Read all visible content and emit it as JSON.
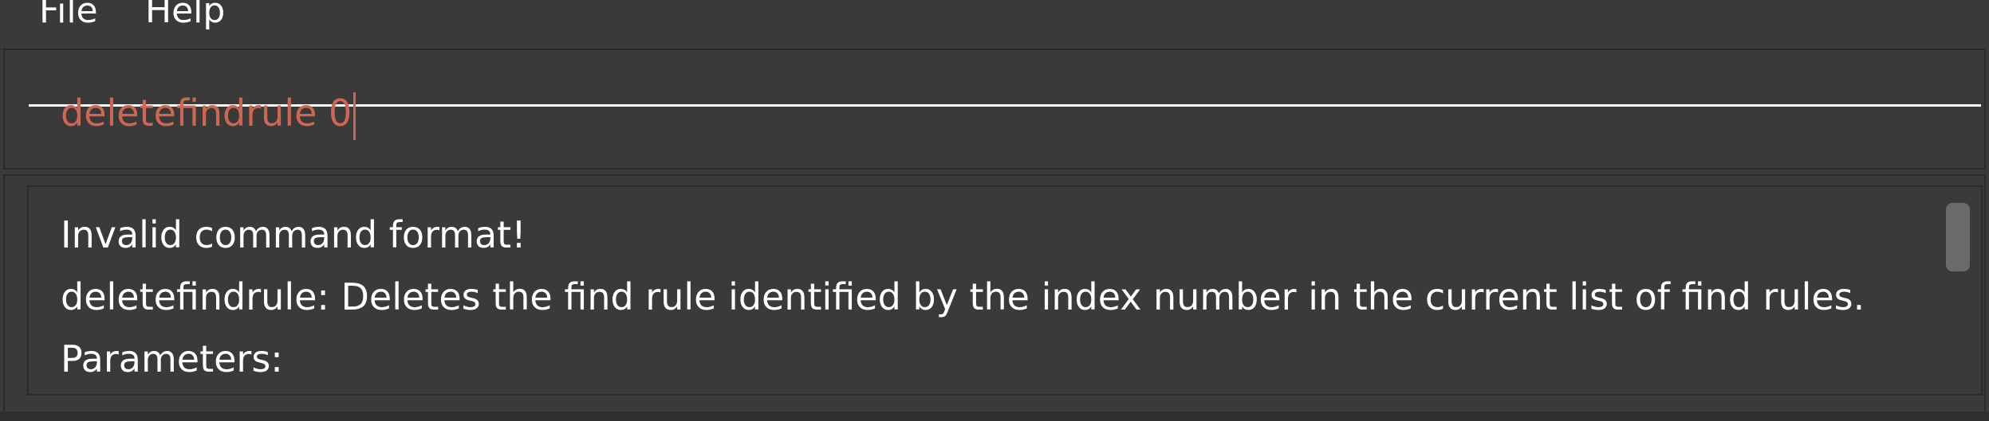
{
  "menubar": {
    "items": [
      {
        "label": "File"
      },
      {
        "label": "Help"
      }
    ]
  },
  "command": {
    "value": "deletefindrule 0"
  },
  "result": {
    "lines": [
      "Invalid command format!",
      "deletefindrule: Deletes the find rule identified by the index number in the current list of find rules.",
      "Parameters:"
    ]
  },
  "colors": {
    "background": "#3a3a3a",
    "command_text": "#d06651",
    "result_text": "#ffffff",
    "underline": "#ffffff",
    "scrollbar": "#6a6a6a"
  }
}
